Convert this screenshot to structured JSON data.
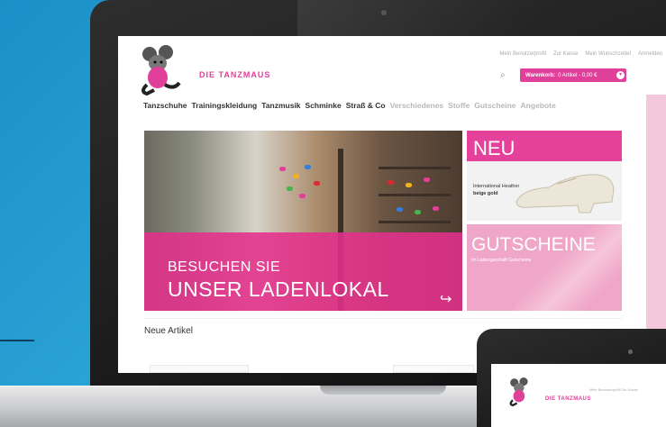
{
  "brand": {
    "name": "DIE TANZMAUS",
    "logo": "mouse-mascot-icon"
  },
  "top_links": [
    "Mein Benutzerprofil",
    "Zur Kasse",
    "Mein Wunschzettel",
    "Anmelden"
  ],
  "search": {
    "icon": "search-icon"
  },
  "cart": {
    "label": "Warenkorb:",
    "value": "0 Artikel - 0,00 €"
  },
  "nav": [
    "Tanzschuhe",
    "Trainingskleidung",
    "Tanzmusik",
    "Schminke",
    "Straß & Co",
    "Verschiedenes",
    "Stoffe",
    "Gutscheine",
    "Angebote"
  ],
  "banner": {
    "line1": "BESUCHEN SIE",
    "line2": "UNSER LADENLOKAL",
    "arrow": "↪"
  },
  "promo_new": {
    "title": "NEU",
    "text1": "International Heather",
    "text2": "beige gold"
  },
  "promo_voucher": {
    "title": "GUTSCHEINE",
    "text": "Im Ladengeschäft Gutscheine"
  },
  "section": {
    "title": "Neue Artikel"
  },
  "phone": {
    "brand": "DIE TANZMAUS",
    "links": "Mein Benutzerprofil  Zur Kasse"
  },
  "colors": {
    "accent": "#e0409a",
    "background": "#1f93cc"
  }
}
